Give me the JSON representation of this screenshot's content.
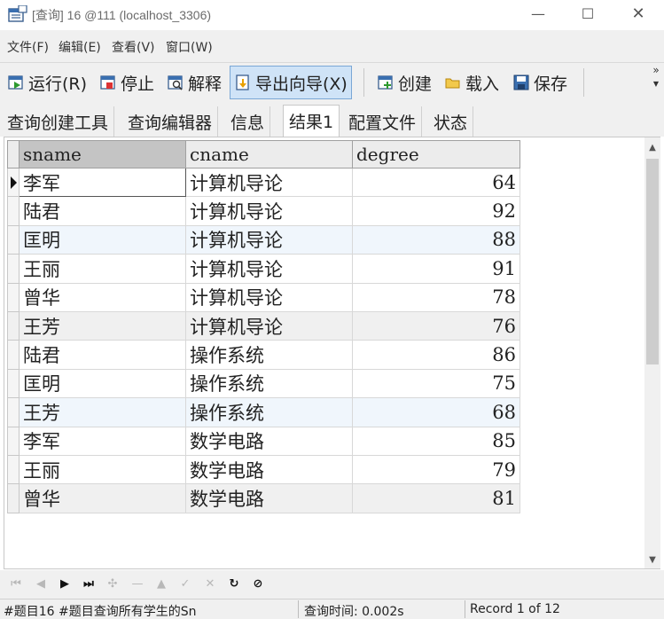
{
  "window": {
    "title": "[查询] 16 @111 (localhost_3306)",
    "min_glyph": "—",
    "max_glyph": "☐",
    "close_glyph": "✕"
  },
  "menu": [
    "文件(F)",
    "编辑(E)",
    "查看(V)",
    "窗口(W)"
  ],
  "toolbar": {
    "run": "运行(R)",
    "stop": "停止",
    "explain": "解释",
    "export_wizard": "导出向导(X)",
    "create": "创建",
    "load": "载入",
    "save": "保存",
    "more_glyph": "»"
  },
  "tabs": [
    "查询创建工具",
    "查询编辑器",
    "信息",
    "结果1",
    "配置文件",
    "状态"
  ],
  "active_tab": "结果1",
  "grid": {
    "columns": [
      "sname",
      "cname",
      "degree"
    ],
    "rows": [
      [
        "李军",
        "计算机导论",
        "64"
      ],
      [
        "陆君",
        "计算机导论",
        "92"
      ],
      [
        "匡明",
        "计算机导论",
        "88"
      ],
      [
        "王丽",
        "计算机导论",
        "91"
      ],
      [
        "曾华",
        "计算机导论",
        "78"
      ],
      [
        "王芳",
        "计算机导论",
        "76"
      ],
      [
        "陆君",
        "操作系统",
        "86"
      ],
      [
        "匡明",
        "操作系统",
        "75"
      ],
      [
        "王芳",
        "操作系统",
        "68"
      ],
      [
        "李军",
        "数学电路",
        "85"
      ],
      [
        "王丽",
        "数学电路",
        "79"
      ],
      [
        "曾华",
        "数学电路",
        "81"
      ]
    ]
  },
  "navigator": {
    "buttons": [
      {
        "name": "first-record-icon",
        "glyph": "⏮",
        "enabled": false
      },
      {
        "name": "prev-record-icon",
        "glyph": "◀",
        "enabled": false
      },
      {
        "name": "next-record-icon",
        "glyph": "▶",
        "enabled": true
      },
      {
        "name": "last-record-icon",
        "glyph": "⏭",
        "enabled": true
      },
      {
        "name": "add-record-icon",
        "glyph": "✣",
        "enabled": false
      },
      {
        "name": "delete-record-icon",
        "glyph": "—",
        "enabled": false
      },
      {
        "name": "edit-record-icon",
        "glyph": "▲",
        "enabled": false
      },
      {
        "name": "apply-record-icon",
        "glyph": "✓",
        "enabled": false
      },
      {
        "name": "cancel-record-icon",
        "glyph": "✕",
        "enabled": false
      },
      {
        "name": "refresh-icon",
        "glyph": "↻",
        "enabled": true
      },
      {
        "name": "stop-icon",
        "glyph": "⊘",
        "enabled": true
      }
    ]
  },
  "status": {
    "query_text": "#题目16 #题目查询所有学生的Sn",
    "query_time": "查询时间: 0.002s",
    "record": "Record 1 of 12"
  },
  "colors": {
    "toolbar_active_bg": "#cfe3f7",
    "row_alt_bg": "#f0f6fc",
    "sorted_header_bg": "#c4c4c4"
  }
}
